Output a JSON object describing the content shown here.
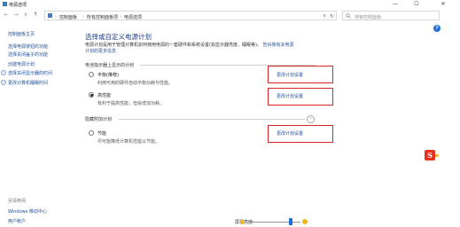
{
  "window": {
    "title": "电源选项",
    "min_glyph": "—",
    "max_glyph": "☐",
    "close_glyph": "✕"
  },
  "address": {
    "back_glyph": "←",
    "forward_glyph": "→",
    "up_glyph": "↑",
    "breadcrumbs": [
      "控制面板",
      "所有控制面板项",
      "电源选项"
    ],
    "separator": "›",
    "dropdown_glyph": "∨",
    "refresh_glyph": "↻",
    "search_placeholder": "搜索控制面板"
  },
  "help": {
    "glyph": "?"
  },
  "sidebar": {
    "items": [
      {
        "label": "控制面板主页",
        "icon": ""
      },
      {
        "label": "选择电源按钮的功能",
        "icon": ""
      },
      {
        "label": "选择关闭盖子的功能",
        "icon": ""
      },
      {
        "label": "创建电源计划",
        "icon": ""
      },
      {
        "label": "选择关闭显示器的时间",
        "icon": "power-icon"
      },
      {
        "label": "更改计算机睡眠时间",
        "icon": "power-icon"
      }
    ],
    "see_also": {
      "heading": "另请参阅",
      "items": [
        "Windows 移动中心",
        "用户帐户"
      ]
    }
  },
  "main": {
    "title": "选择或自定义电源计划",
    "description": "电源计划是用于管理计算机如何使用电源的一套硬件和系统设置(如显示器亮度、睡眠等)。",
    "description_link": "告诉我有关电源计划的更多信息",
    "group_shown": "电池指示器上显示的计划",
    "group_hidden": "隐藏附加计划",
    "collapse_glyph": "⌃",
    "plans": [
      {
        "name": "平衡(推荐)",
        "desc": "利用可用的硬件自动平衡功耗与性能。",
        "link": "更改计划设置",
        "selected": false
      },
      {
        "name": "高性能",
        "desc": "有利于提高性能，但会增加功耗。",
        "link": "更改计划设置",
        "selected": true
      },
      {
        "name": "节能",
        "desc": "尽可能降低计算机性能以节能。",
        "link": "更改计划设置",
        "selected": false
      }
    ]
  },
  "footer": {
    "brightness_label": "屏幕亮度:",
    "brightness_level": 0.82
  },
  "brand": {
    "letter": "S"
  },
  "colors": {
    "accent": "#1e6fd9",
    "link": "#1e4f9c",
    "title": "#1f3f8f",
    "highlight": "#d9252a"
  }
}
